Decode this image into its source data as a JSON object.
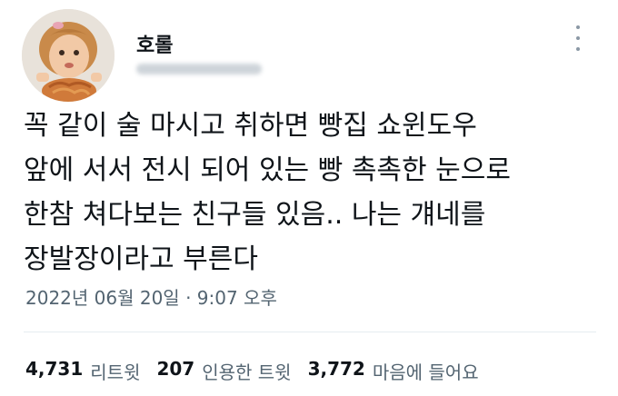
{
  "author": {
    "display_name": "호롤",
    "avatar": "avatar-girl-eating-noodles"
  },
  "tweet": {
    "lines": [
      "꼭 같이 술 마시고 취하면 빵집 쇼윈도우",
      "앞에 서서 전시 되어 있는 빵 촉촉한 눈으로",
      "한참 쳐다보는 친구들 있음.. 나는 걔네를",
      "장발장이라고 부른다"
    ],
    "timestamp": "2022년 06월 20일 · 9:07 오후"
  },
  "stats": {
    "retweets": {
      "count": "4,731",
      "label": "리트윗"
    },
    "quotes": {
      "count": "207",
      "label": "인용한 트윗"
    },
    "likes": {
      "count": "3,772",
      "label": "마음에 들어요"
    }
  },
  "icons": {
    "more": "more-vertical-icon"
  },
  "colors": {
    "text": "#0f1419",
    "secondary": "#536471",
    "divider": "#e6ecf0"
  }
}
